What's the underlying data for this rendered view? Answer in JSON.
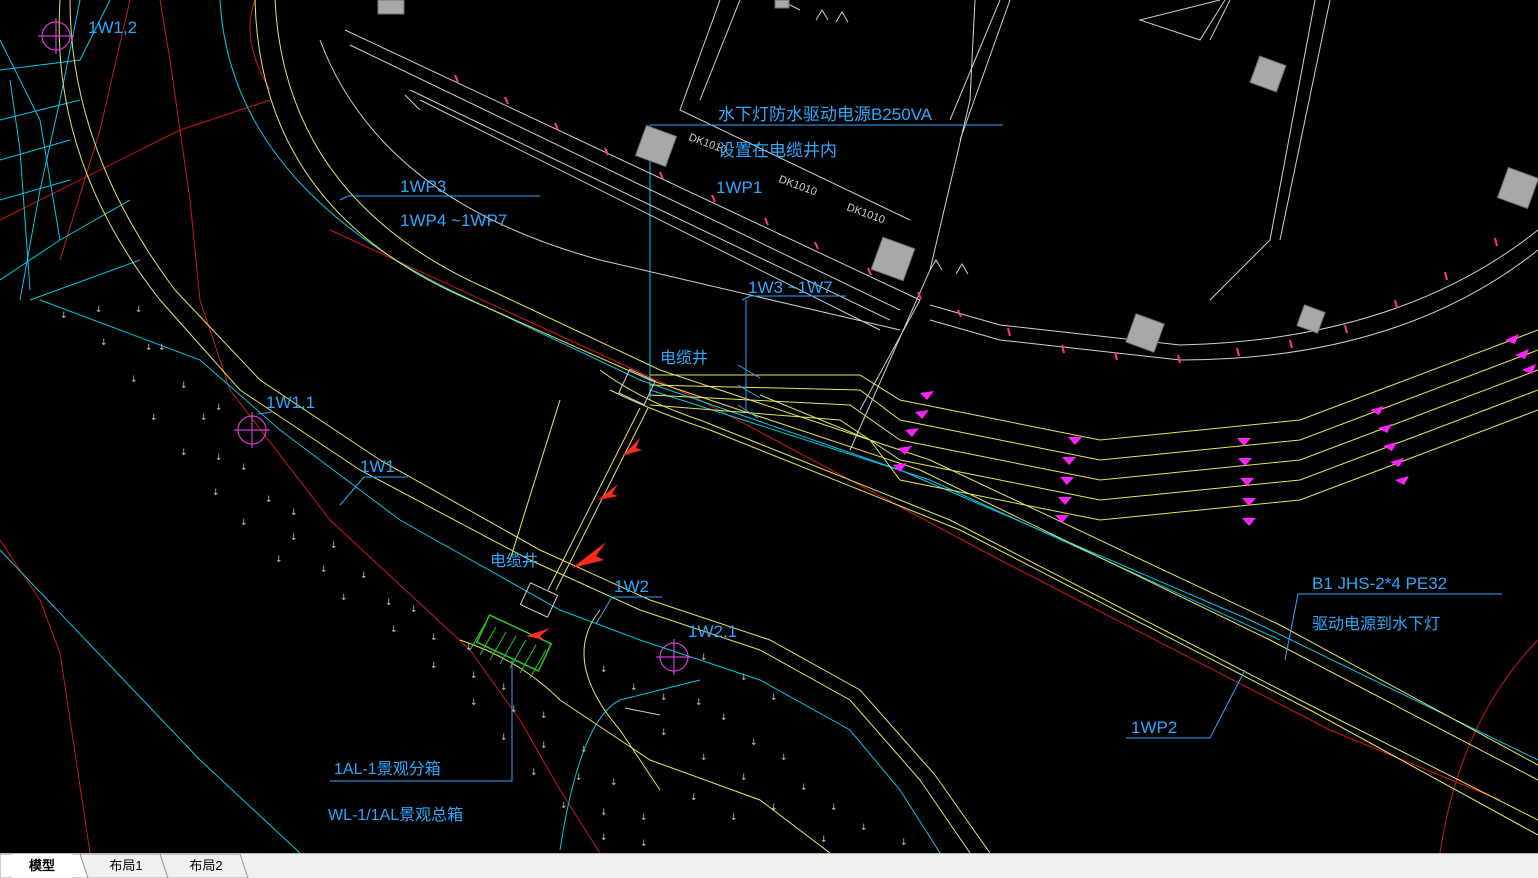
{
  "drawing": {
    "labels": {
      "w1_2": "1W1,2",
      "w1_1": "1W1,1",
      "w1": "1W1",
      "w2": "1W2",
      "w2_1": "1W2,1",
      "wp3": "1WP3",
      "wp4_7": "1WP4 ~1WP7",
      "wp1": "1WP1",
      "wp2": "1WP2",
      "w3_7": "1W3 ~1W7",
      "driver_line1": "水下灯防水驱动电源B250VA",
      "driver_line2": "设置在电缆井内",
      "cable_well_top": "电缆井",
      "cable_well_bottom": "电缆井",
      "cable_spec": "B1 JHS-2*4 PE32",
      "cable_desc": "驱动电源到水下灯",
      "box_1al": "1AL-1景观分箱",
      "box_wl": "WL-1/1AL景观总箱",
      "dk1": "DK1010",
      "dk2": "DK1010",
      "dk3": "DK1010"
    },
    "colors": {
      "background": "#000000",
      "cyan": "#00c8e8",
      "yellow": "#e6e65a",
      "red": "#d01818",
      "white": "#d0d0d0",
      "magenta": "#ff22ff",
      "green": "#28c828",
      "label_blue": "#2aa9ff"
    }
  },
  "tabs": [
    {
      "label": "模型",
      "active": true
    },
    {
      "label": "布局1",
      "active": false
    },
    {
      "label": "布局2",
      "active": false
    }
  ]
}
